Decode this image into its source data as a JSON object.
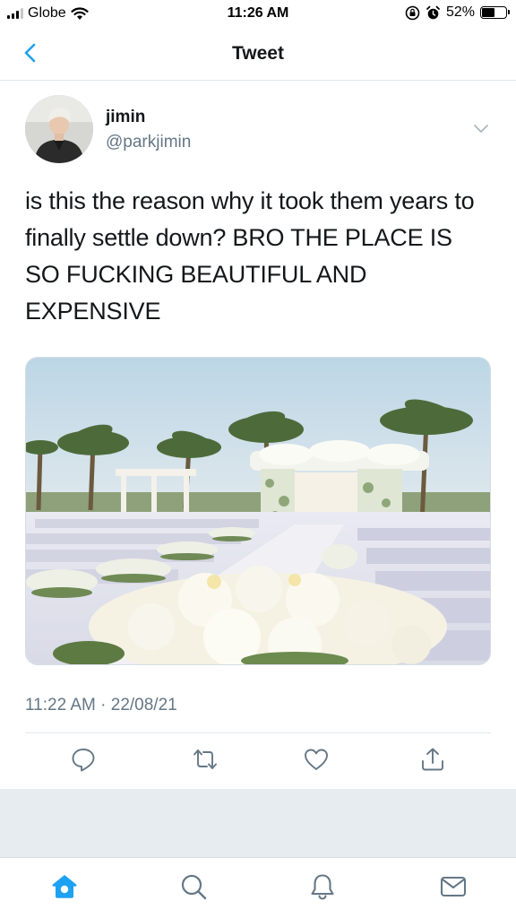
{
  "status_bar": {
    "carrier": "Globe",
    "time": "11:26 AM",
    "battery_percent": "52%",
    "battery_level": 0.52,
    "icons": [
      "signal-icon",
      "wifi-icon",
      "screen-lock-icon",
      "alarm-icon",
      "battery-icon"
    ]
  },
  "nav": {
    "title": "Tweet",
    "back_icon": "chevron-left-icon"
  },
  "tweet": {
    "author_name": "jimin",
    "author_handle": "@parkjimin",
    "text": "is this the reason why it took them years to finally settle down? BRO THE PLACE IS SO FUCKING BEAUTIFUL AND EXPENSIVE",
    "timestamp": "11:22 AM · 22/08/21",
    "media": "wedding-venue-photo"
  },
  "actions": [
    {
      "name": "reply-icon"
    },
    {
      "name": "retweet-icon"
    },
    {
      "name": "like-icon"
    },
    {
      "name": "share-icon"
    }
  ],
  "tabs": [
    {
      "name": "home-icon",
      "active": true
    },
    {
      "name": "search-icon",
      "active": false
    },
    {
      "name": "notifications-icon",
      "active": false
    },
    {
      "name": "messages-icon",
      "active": false
    }
  ],
  "colors": {
    "accent": "#1da1f2",
    "secondary_text": "#657786",
    "divider": "#e1e8ed",
    "background_gray": "#e6ecf0"
  }
}
